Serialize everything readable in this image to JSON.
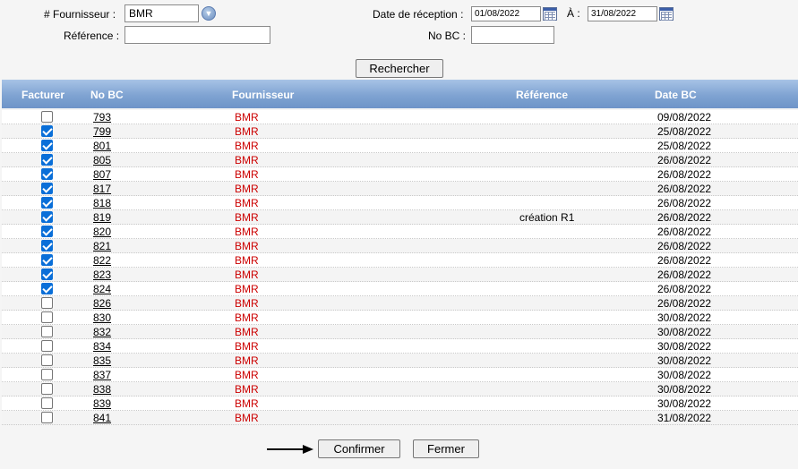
{
  "form": {
    "fournisseur_label": "# Fournisseur :",
    "fournisseur_value": "BMR",
    "reference_label": "Référence :",
    "reference_value": "",
    "date_reception_label": "Date de réception :",
    "date_from": "01/08/2022",
    "a_label": "À :",
    "date_to": "31/08/2022",
    "nobc_label": "No BC :",
    "nobc_value": "",
    "search_button": "Rechercher"
  },
  "table": {
    "headers": {
      "facturer": "Facturer",
      "nobc": "No BC",
      "fournisseur": "Fournisseur",
      "reference": "Référence",
      "date_bc": "Date BC"
    },
    "rows": [
      {
        "checked": false,
        "nobc": "793",
        "fournisseur": "BMR",
        "reference": "",
        "date": "09/08/2022"
      },
      {
        "checked": true,
        "nobc": "799",
        "fournisseur": "BMR",
        "reference": "",
        "date": "25/08/2022"
      },
      {
        "checked": true,
        "nobc": "801",
        "fournisseur": "BMR",
        "reference": "",
        "date": "25/08/2022"
      },
      {
        "checked": true,
        "nobc": "805",
        "fournisseur": "BMR",
        "reference": "",
        "date": "26/08/2022"
      },
      {
        "checked": true,
        "nobc": "807",
        "fournisseur": "BMR",
        "reference": "",
        "date": "26/08/2022"
      },
      {
        "checked": true,
        "nobc": "817",
        "fournisseur": "BMR",
        "reference": "",
        "date": "26/08/2022"
      },
      {
        "checked": true,
        "nobc": "818",
        "fournisseur": "BMR",
        "reference": "",
        "date": "26/08/2022"
      },
      {
        "checked": true,
        "nobc": "819",
        "fournisseur": "BMR",
        "reference": "création R1",
        "date": "26/08/2022"
      },
      {
        "checked": true,
        "nobc": "820",
        "fournisseur": "BMR",
        "reference": "",
        "date": "26/08/2022"
      },
      {
        "checked": true,
        "nobc": "821",
        "fournisseur": "BMR",
        "reference": "",
        "date": "26/08/2022"
      },
      {
        "checked": true,
        "nobc": "822",
        "fournisseur": "BMR",
        "reference": "",
        "date": "26/08/2022"
      },
      {
        "checked": true,
        "nobc": "823",
        "fournisseur": "BMR",
        "reference": "",
        "date": "26/08/2022"
      },
      {
        "checked": true,
        "nobc": "824",
        "fournisseur": "BMR",
        "reference": "",
        "date": "26/08/2022"
      },
      {
        "checked": false,
        "nobc": "826",
        "fournisseur": "BMR",
        "reference": "",
        "date": "26/08/2022"
      },
      {
        "checked": false,
        "nobc": "830",
        "fournisseur": "BMR",
        "reference": "",
        "date": "30/08/2022"
      },
      {
        "checked": false,
        "nobc": "832",
        "fournisseur": "BMR",
        "reference": "",
        "date": "30/08/2022"
      },
      {
        "checked": false,
        "nobc": "834",
        "fournisseur": "BMR",
        "reference": "",
        "date": "30/08/2022"
      },
      {
        "checked": false,
        "nobc": "835",
        "fournisseur": "BMR",
        "reference": "",
        "date": "30/08/2022"
      },
      {
        "checked": false,
        "nobc": "837",
        "fournisseur": "BMR",
        "reference": "",
        "date": "30/08/2022"
      },
      {
        "checked": false,
        "nobc": "838",
        "fournisseur": "BMR",
        "reference": "",
        "date": "30/08/2022"
      },
      {
        "checked": false,
        "nobc": "839",
        "fournisseur": "BMR",
        "reference": "",
        "date": "30/08/2022"
      },
      {
        "checked": false,
        "nobc": "841",
        "fournisseur": "BMR",
        "reference": "",
        "date": "31/08/2022"
      }
    ]
  },
  "footer": {
    "confirm_button": "Confirmer",
    "close_button": "Fermer"
  },
  "colors": {
    "header_gradient_top": "#a7c3e6",
    "header_gradient_bottom": "#6e94c8",
    "supplier_text": "#cc0000",
    "checkbox_checked": "#0a6fd8"
  },
  "icons": {
    "dropdown": "chevron-down-icon",
    "calendar": "calendar-icon",
    "annotation_arrow": "arrow-right-icon"
  }
}
